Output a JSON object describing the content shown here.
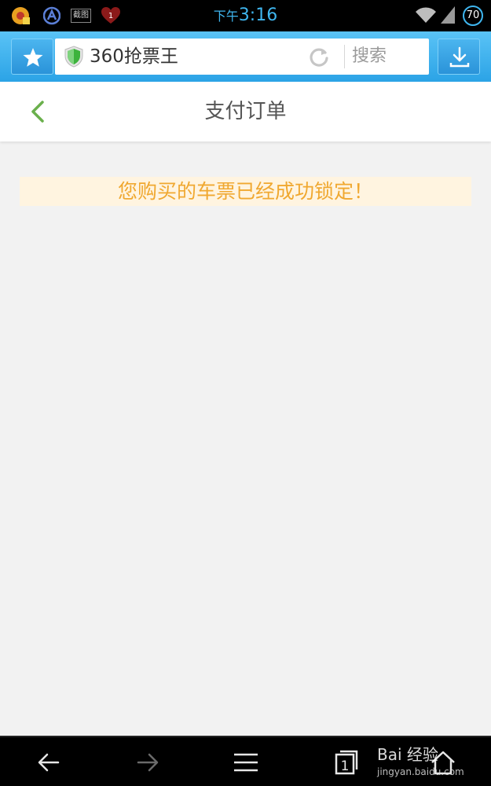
{
  "status_bar": {
    "time_prefix": "下午",
    "time": "3:16",
    "battery": "70",
    "icons": [
      "browser-icon",
      "nav-a-icon",
      "screenshot-icon",
      "heart-notification-icon",
      "wifi-icon",
      "signal-icon"
    ],
    "screenshot_label": "截图",
    "notification_count": "1",
    "time_color": "#3fb6ef"
  },
  "browser": {
    "url_title": "360抢票王",
    "search_label": "搜索",
    "accent": "#2ba3e6"
  },
  "page": {
    "title": "支付订单",
    "notice": "您购买的车票已经成功锁定！",
    "notice_color": "#f0a830",
    "back_color": "#6ab04c"
  },
  "bottom_nav": {
    "tab_count": "1"
  },
  "watermark": {
    "text": "Bai 经验",
    "sub": "jingyan.baidu.com"
  }
}
